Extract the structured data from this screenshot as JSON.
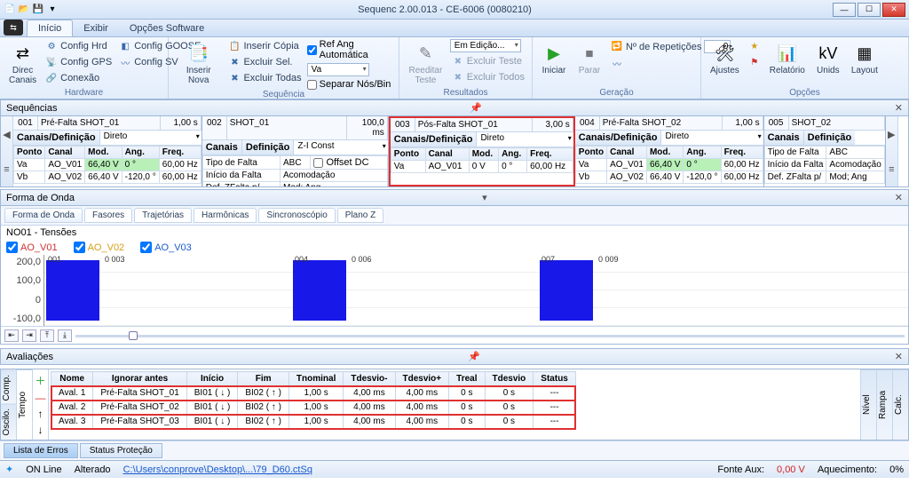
{
  "window": {
    "title": "Sequenc 2.00.013 - CE-6006 (0080210)"
  },
  "menu_tabs": {
    "t1": "Início",
    "t2": "Exibir",
    "t3": "Opções Software"
  },
  "ribbon": {
    "hardware": {
      "label": "Hardware",
      "direc": "Direc\nCanais",
      "hrd": "Config Hrd",
      "goose": "Config GOOSE",
      "gps": "Config GPS",
      "sv": "Config SV",
      "conexao": "Conexão"
    },
    "sequencia": {
      "label": "Sequência",
      "inserir": "Inserir\nNova",
      "copia": "Inserir Cópia",
      "excl_sel": "Excluir Sel.",
      "excl_todas": "Excluir Todas",
      "ref_ang": "Ref Ang Automática",
      "va": "Va",
      "separar": "Separar Nós/Bin"
    },
    "resultados": {
      "label": "Resultados",
      "reeditar": "Reeditar\nTeste",
      "em_edicao": "Em Edição...",
      "excl_teste": "Excluir Teste",
      "excl_todos": "Excluir Todos"
    },
    "geracao": {
      "label": "Geração",
      "iniciar": "Iniciar",
      "parar": "Parar",
      "nrep": "Nº de Repetições",
      "nrep_val": "0"
    },
    "opcoes": {
      "label": "Opções",
      "ajustes": "Ajustes",
      "relatorio": "Relatório",
      "unids": "Unids",
      "layout": "Layout"
    }
  },
  "seq": {
    "header": "Sequências",
    "col": {
      "ponto": "Ponto",
      "canal": "Canal",
      "mod": "Mod.",
      "ang": "Ang.",
      "freq": "Freq."
    },
    "def_lbl": "Canais/Definição",
    "canais_lbl": "Canais",
    "def2_lbl": "Definição",
    "direto": "Direto",
    "ziconst": "Z-I Const",
    "tf_lbl": "Tipo de Falta",
    "tf_val": "ABC",
    "offset": "Offset DC",
    "ini_lbl": "Início da Falta",
    "ini_val": "Acomodação",
    "defz_lbl": "Def. ZFalta p/",
    "defz_val": "Mod; Ang",
    "cards": [
      {
        "num": "001",
        "name": "Pré-Falta SHOT_01",
        "dur": "1,00 s"
      },
      {
        "num": "002",
        "name": "SHOT_01",
        "dur": "100,0 ms"
      },
      {
        "num": "003",
        "name": "Pós-Falta SHOT_01",
        "dur": "3,00 s"
      },
      {
        "num": "004",
        "name": "Pré-Falta SHOT_02",
        "dur": "1,00 s"
      },
      {
        "num": "005",
        "name": "SHOT_02"
      }
    ],
    "r1": {
      "p": "Va",
      "c": "AO_V01",
      "m": "66,40 V",
      "a": "0 °",
      "f": "60,00 Hz"
    },
    "r2": {
      "p": "Vb",
      "c": "AO_V02",
      "m": "66,40 V",
      "a": "-120,0 °",
      "f": "60,00 Hz"
    },
    "r3": {
      "p": "Va",
      "c": "AO_V01",
      "m": "0 V",
      "a": "0 °",
      "f": "60,00 Hz"
    }
  },
  "wave": {
    "header": "Forma de Onda",
    "tabs": {
      "t1": "Forma de Onda",
      "t2": "Fasores",
      "t3": "Trajetórias",
      "t4": "Harmônicas",
      "t5": "Sincronoscópio",
      "t6": "Plano Z"
    },
    "group": "NO01 - Tensões",
    "leg": {
      "a": "AO_V01",
      "b": "AO_V02",
      "c": "AO_V03"
    },
    "y": {
      "y0": "200,0",
      "y1": "100,0",
      "y2": "0",
      "y3": "-100,0"
    },
    "m": {
      "m1": "001",
      "m2": "0 003",
      "m3": "004",
      "m4": "0 006",
      "m5": "007",
      "m6": "0 009"
    }
  },
  "eval": {
    "header": "Avaliações",
    "vt": {
      "comp": "Comp.",
      "oscilo": "Oscilo.",
      "tempo": "Tempo",
      "nivel": "Nível",
      "rampa": "Rampa",
      "calc": "Calc."
    },
    "cols": {
      "nome": "Nome",
      "ign": "Ignorar antes",
      "ini": "Início",
      "fim": "Fim",
      "tnom": "Tnominal",
      "tdm": "Tdesvio-",
      "tdp": "Tdesvio+",
      "treal": "Treal",
      "tdes": "Tdesvio",
      "status": "Status"
    },
    "rows": [
      {
        "nome": "Aval. 1",
        "ign": "Pré-Falta SHOT_01",
        "ini": "BI01  ( ↓ )",
        "fim": "BI02  ( ↑ )",
        "tnom": "1,00 s",
        "tdm": "4,00 ms",
        "tdp": "4,00 ms",
        "treal": "0 s",
        "tdes": "0 s",
        "status": "---"
      },
      {
        "nome": "Aval. 2",
        "ign": "Pré-Falta SHOT_02",
        "ini": "BI01  ( ↓ )",
        "fim": "BI02  ( ↑ )",
        "tnom": "1,00 s",
        "tdm": "4,00 ms",
        "tdp": "4,00 ms",
        "treal": "0 s",
        "tdes": "0 s",
        "status": "---"
      },
      {
        "nome": "Aval. 3",
        "ign": "Pré-Falta SHOT_03",
        "ini": "BI01  ( ↓ )",
        "fim": "BI02  ( ↑ )",
        "tnom": "1,00 s",
        "tdm": "4,00 ms",
        "tdp": "4,00 ms",
        "treal": "0 s",
        "tdes": "0 s",
        "status": "---"
      }
    ]
  },
  "btabs": {
    "t1": "Lista de Erros",
    "t2": "Status Proteção"
  },
  "status": {
    "online": "ON Line",
    "alt": "Alterado",
    "path": "C:\\Users\\conprove\\Desktop\\...\\79_D60.ctSq",
    "fonte": "Fonte Aux:",
    "fonte_v": "0,00 V",
    "aquec": "Aquecimento:",
    "aquec_v": "0%"
  }
}
